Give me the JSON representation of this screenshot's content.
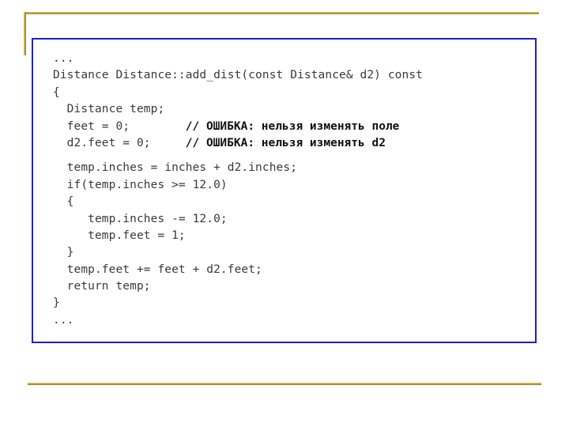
{
  "slide": {
    "background_color": "#ffffff",
    "accent_gold": "#b3a23c",
    "frame_border_color": "#1f1fd0",
    "code_text_color": "#3a3a3a",
    "comment_text_color": "#111111"
  },
  "decor": {
    "top_rule_name": "gold-top-rule",
    "left_rule_name": "gold-left-rule",
    "bottom_rule_name": "gold-bottom-rule"
  },
  "code": {
    "language": "cpp",
    "lines": [
      {
        "text": "...",
        "comment": "",
        "gap_before": false
      },
      {
        "text": "Distance Distance::add_dist(const Distance& d2) const",
        "comment": "",
        "gap_before": false
      },
      {
        "text": "{",
        "comment": "",
        "gap_before": false
      },
      {
        "text": "  Distance temp;",
        "comment": "",
        "gap_before": false
      },
      {
        "text": "  feet = 0;        ",
        "comment": "// ОШИБКА: нельзя изменять поле",
        "gap_before": false
      },
      {
        "text": "  d2.feet = 0;     ",
        "comment": "// ОШИБКА: нельзя изменять d2",
        "gap_before": false
      },
      {
        "text": "  temp.inches = inches + d2.inches;",
        "comment": "",
        "gap_before": true
      },
      {
        "text": "  if(temp.inches >= 12.0)",
        "comment": "",
        "gap_before": false
      },
      {
        "text": "  {",
        "comment": "",
        "gap_before": false
      },
      {
        "text": "     temp.inches -= 12.0;",
        "comment": "",
        "gap_before": false
      },
      {
        "text": "     temp.feet = 1;",
        "comment": "",
        "gap_before": false
      },
      {
        "text": "  }",
        "comment": "",
        "gap_before": false
      },
      {
        "text": "  temp.feet += feet + d2.feet;",
        "comment": "",
        "gap_before": false
      },
      {
        "text": "  return temp;",
        "comment": "",
        "gap_before": false
      },
      {
        "text": "}",
        "comment": "",
        "gap_before": false
      },
      {
        "text": "...",
        "comment": "",
        "gap_before": false
      }
    ]
  }
}
